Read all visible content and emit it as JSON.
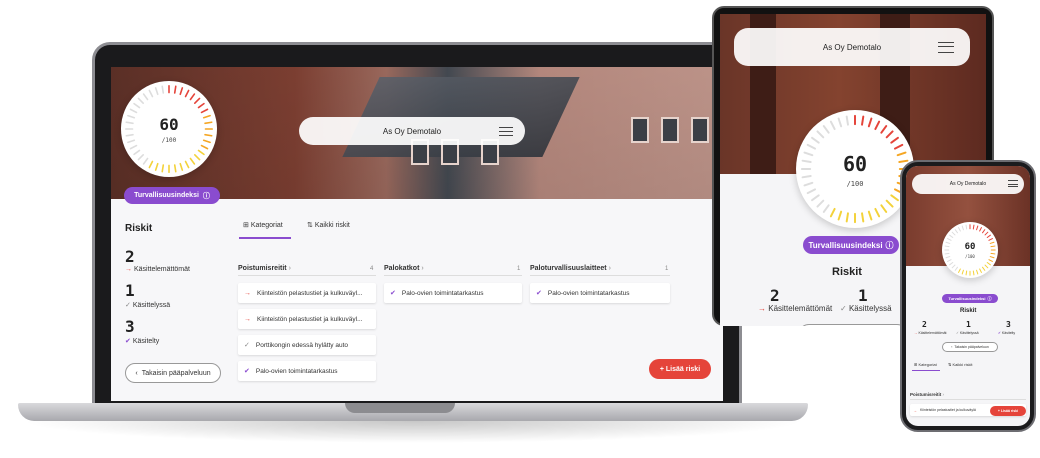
{
  "app": {
    "building_name": "As Oy Demotalo",
    "score": "60",
    "score_max": "/100",
    "index_label": "Turvallisuusindeksi",
    "risks_title": "Riskit",
    "back_label": "Takaisin pääpalveluun",
    "add_risk_label": "+ Lisää riski"
  },
  "stats": [
    {
      "value": "2",
      "label": "Käsittelemättömät",
      "icon": "arrow-right-icon"
    },
    {
      "value": "1",
      "label": "Käsittelyssä",
      "icon": "check-icon"
    },
    {
      "value": "3",
      "label": "Käsitelty",
      "icon": "double-check-icon"
    }
  ],
  "tabs": [
    {
      "label": "Kategoriat",
      "icon": "grid-icon",
      "active": true
    },
    {
      "label": "Kaikki riskit",
      "icon": "list-icon",
      "active": false
    }
  ],
  "columns": [
    {
      "title": "Poistumisreitit",
      "count": "4",
      "cards": [
        {
          "text": "Kiinteistön pelastustiet ja kulkuväyl...",
          "status": "new"
        },
        {
          "text": "Kiinteistön pelastustiet ja kulkuväyl...",
          "status": "new"
        },
        {
          "text": "Porttikongin edessä hylätty auto",
          "status": "in-progress"
        },
        {
          "text": "Palo-ovien toimintatarkastus",
          "status": "done"
        }
      ]
    },
    {
      "title": "Palokatkot",
      "count": "1",
      "cards": [
        {
          "text": "Palo-ovien toimintatarkastus",
          "status": "done"
        }
      ]
    },
    {
      "title": "Paloturvallisuuslaitteet",
      "count": "1",
      "cards": [
        {
          "text": "Palo-ovien toimintatarkastus",
          "status": "done"
        }
      ]
    }
  ],
  "phone": {
    "first_card": "Kiinteistön pelastustiet ja kulkuväylä",
    "add_risk_label": "+ Lisää riski"
  },
  "colors": {
    "accent": "#8a4ccf",
    "danger": "#e5443a",
    "gauge_high": "#e5443a",
    "gauge_mid": "#f5a623",
    "gauge_low": "#f3d23a"
  }
}
